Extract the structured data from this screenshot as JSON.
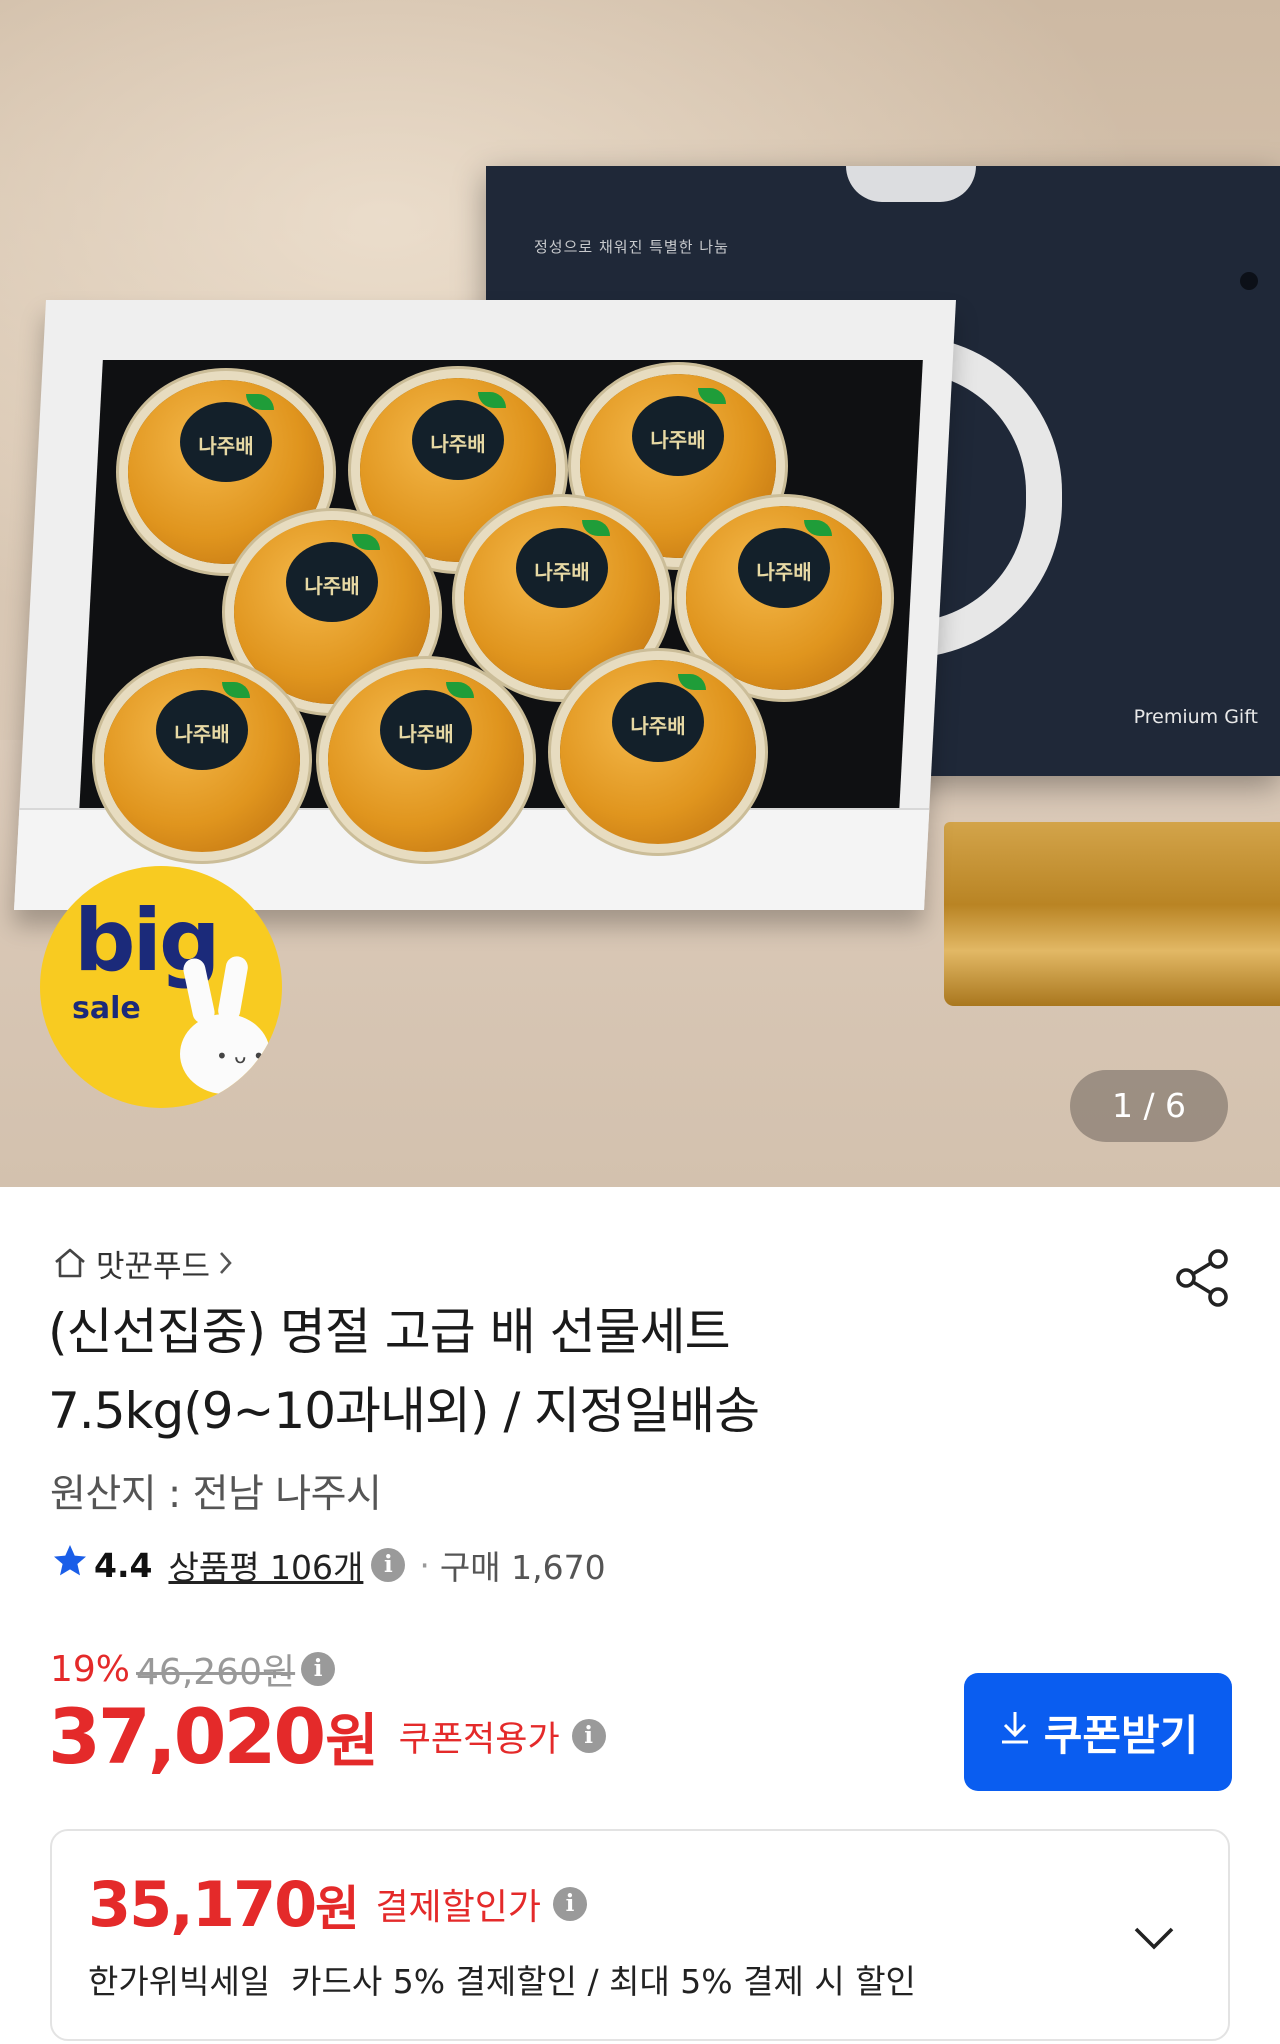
{
  "hero": {
    "box_tagline": "정성으로 채워진 특별한 나눔",
    "box_brand": "Premium Gift",
    "pear_label": "나주배",
    "badge_big": "big",
    "badge_sale": "sale",
    "image_counter": "1 / 6"
  },
  "store": {
    "name": "맛꾼푸드",
    "home_icon": "home-icon",
    "chevron_icon": "chevron-right-icon"
  },
  "share_icon": "share-icon",
  "product": {
    "title_line1": "(신선집중) 명절 고급 배 선물세트",
    "title_line2": "7.5kg(9~10과내외) / 지정일배송",
    "origin": "원산지 : 전남 나주시"
  },
  "rating": {
    "score": "4.4",
    "reviews": "상품평 106개",
    "separator": "·",
    "purchases": "구매 1,670"
  },
  "pricing": {
    "discount_pct": "19%",
    "original_price": "46,260원",
    "coupon_price": "37,020",
    "currency": "원",
    "coupon_price_label": "쿠폰적용가",
    "coupon_button": "쿠폰받기",
    "payment_price": "35,170",
    "payment_label": "결제할인가",
    "payment_desc": "한가위빅세일  카드사 5% 결제할인 / 최대 5% 결제 시 할인"
  },
  "colors": {
    "accent_red": "#e42a2a",
    "button_blue": "#0a5df0",
    "star_blue": "#1a5ee8"
  }
}
